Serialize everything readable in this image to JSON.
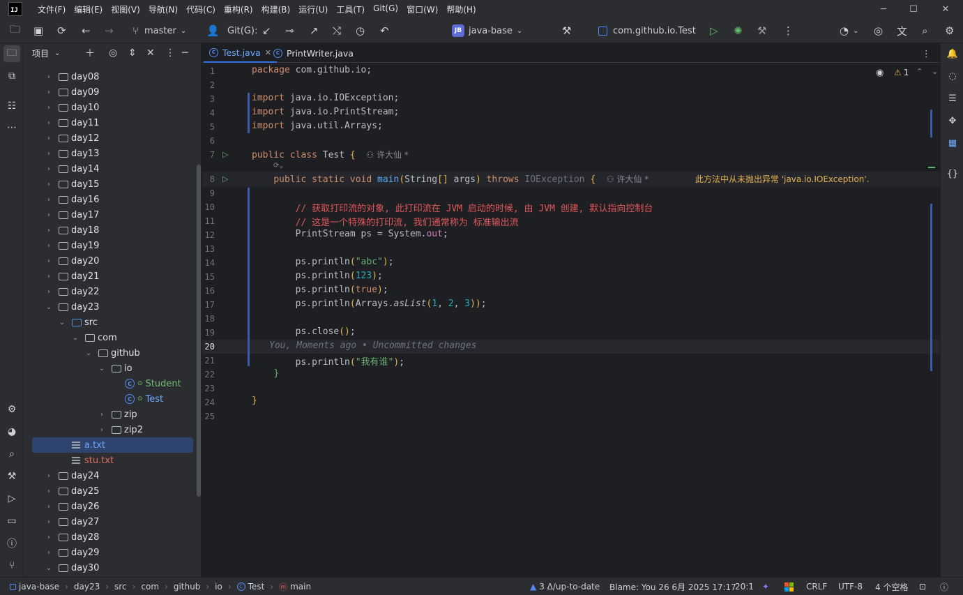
{
  "menubar": {
    "items": [
      "文件(F)",
      "编辑(E)",
      "视图(V)",
      "导航(N)",
      "代码(C)",
      "重构(R)",
      "构建(B)",
      "运行(U)",
      "工具(T)",
      "Git(G)",
      "窗口(W)",
      "帮助(H)"
    ]
  },
  "toolbar": {
    "branch": "master",
    "git_label": "Git(G):",
    "project_badge": "JB",
    "project": "java-base",
    "run_config": "com.github.io.Test"
  },
  "project_panel": {
    "title": "项目"
  },
  "tree": [
    {
      "label": "day08",
      "level": 1,
      "kind": "folder",
      "expanded": false
    },
    {
      "label": "day09",
      "level": 1,
      "kind": "folder",
      "expanded": false
    },
    {
      "label": "day10",
      "level": 1,
      "kind": "folder",
      "expanded": false
    },
    {
      "label": "day11",
      "level": 1,
      "kind": "folder",
      "expanded": false
    },
    {
      "label": "day12",
      "level": 1,
      "kind": "folder",
      "expanded": false
    },
    {
      "label": "day13",
      "level": 1,
      "kind": "folder",
      "expanded": false
    },
    {
      "label": "day14",
      "level": 1,
      "kind": "folder",
      "expanded": false
    },
    {
      "label": "day15",
      "level": 1,
      "kind": "folder",
      "expanded": false
    },
    {
      "label": "day16",
      "level": 1,
      "kind": "folder",
      "expanded": false
    },
    {
      "label": "day17",
      "level": 1,
      "kind": "folder",
      "expanded": false
    },
    {
      "label": "day18",
      "level": 1,
      "kind": "folder",
      "expanded": false
    },
    {
      "label": "day19",
      "level": 1,
      "kind": "folder",
      "expanded": false
    },
    {
      "label": "day20",
      "level": 1,
      "kind": "folder",
      "expanded": false
    },
    {
      "label": "day21",
      "level": 1,
      "kind": "folder",
      "expanded": false
    },
    {
      "label": "day22",
      "level": 1,
      "kind": "folder",
      "expanded": false
    },
    {
      "label": "day23",
      "level": 1,
      "kind": "folder",
      "expanded": true
    },
    {
      "label": "src",
      "level": 2,
      "kind": "src",
      "expanded": true
    },
    {
      "label": "com",
      "level": 3,
      "kind": "folder",
      "expanded": true
    },
    {
      "label": "github",
      "level": 4,
      "kind": "folder",
      "expanded": true
    },
    {
      "label": "io",
      "level": 5,
      "kind": "folder",
      "expanded": true
    },
    {
      "label": "Student",
      "level": 6,
      "kind": "class",
      "color": "green"
    },
    {
      "label": "Test",
      "level": 6,
      "kind": "class",
      "color": "blue"
    },
    {
      "label": "zip",
      "level": 5,
      "kind": "folder",
      "expanded": false
    },
    {
      "label": "zip2",
      "level": 5,
      "kind": "folder",
      "expanded": false
    },
    {
      "label": "a.txt",
      "level": 2,
      "kind": "file",
      "color": "blue",
      "selected": true
    },
    {
      "label": "stu.txt",
      "level": 2,
      "kind": "file",
      "color": "red"
    },
    {
      "label": "day24",
      "level": 1,
      "kind": "folder",
      "expanded": false
    },
    {
      "label": "day25",
      "level": 1,
      "kind": "folder",
      "expanded": false
    },
    {
      "label": "day26",
      "level": 1,
      "kind": "folder",
      "expanded": false
    },
    {
      "label": "day27",
      "level": 1,
      "kind": "folder",
      "expanded": false
    },
    {
      "label": "day28",
      "level": 1,
      "kind": "folder",
      "expanded": false
    },
    {
      "label": "day29",
      "level": 1,
      "kind": "folder",
      "expanded": false
    },
    {
      "label": "day30",
      "level": 1,
      "kind": "folder",
      "expanded": true
    }
  ],
  "tabs": [
    {
      "label": "Test.java",
      "active": true
    },
    {
      "label": "PrintWriter.java",
      "active": false
    }
  ],
  "editor": {
    "line_numbers": [
      "1",
      "2",
      "3",
      "4",
      "5",
      "6",
      "7",
      "8",
      "9",
      "10",
      "11",
      "12",
      "13",
      "14",
      "15",
      "16",
      "17",
      "18",
      "19",
      "20",
      "21",
      "22",
      "23",
      "24",
      "25"
    ],
    "author": "许大仙 *",
    "warning_count": "1",
    "warning_message": "此方法中从未抛出异常 'java.io.IOException'.",
    "blame_inline": "You, Moments ago • Uncommitted changes",
    "comment1": "// 获取打印流的对象, 此打印流在 JVM 启动的时候, 由 JVM 创建, 默认指向控制台",
    "comment2": "// 这是一个特殊的打印流, 我们通常称为 标准输出流",
    "str_abc": "\"abc\"",
    "str_who": "\"我有谁\""
  },
  "statusbar": {
    "breadcrumb": [
      "java-base",
      "day23",
      "src",
      "com",
      "github",
      "io",
      "Test",
      "main"
    ],
    "git_status": "3 Δ/up-to-date",
    "blame": "Blame: You 26 6月 2025 17:17",
    "position": "20:1",
    "line_sep": "CRLF",
    "encoding": "UTF-8",
    "indent": "4 个空格"
  },
  "colors": {
    "accent": "#3574f0",
    "keyword": "#cf8e6d",
    "string": "#6aab73",
    "number": "#2aacb8",
    "comment": "#e0575b",
    "warning": "#e6b450"
  }
}
